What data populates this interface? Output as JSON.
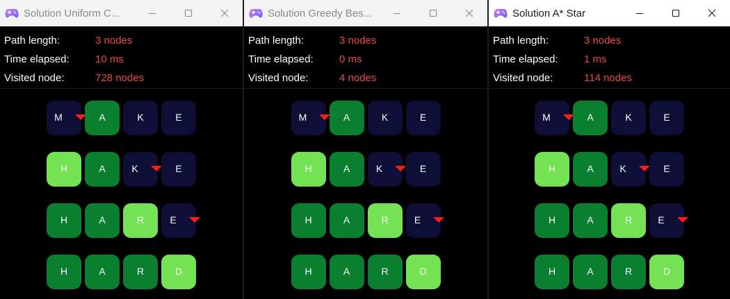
{
  "windows": [
    {
      "title": "Solution Uniform C...",
      "active": false,
      "stats": [
        {
          "label": "Path length:",
          "value": "3 nodes"
        },
        {
          "label": "Time elapsed:",
          "value": "10 ms"
        },
        {
          "label": "Visited node:",
          "value": "728 nodes"
        }
      ]
    },
    {
      "title": "Solution Greedy Bes...",
      "active": false,
      "stats": [
        {
          "label": "Path length:",
          "value": "3 nodes"
        },
        {
          "label": "Time elapsed:",
          "value": "0 ms"
        },
        {
          "label": "Visited node:",
          "value": "4 nodes"
        }
      ]
    },
    {
      "title": "Solution A* Star",
      "active": true,
      "stats": [
        {
          "label": "Path length:",
          "value": "3 nodes"
        },
        {
          "label": "Time elapsed:",
          "value": "1 ms"
        },
        {
          "label": "Visited node:",
          "value": "114 nodes"
        }
      ]
    }
  ],
  "word_ladder": [
    [
      {
        "c": "M",
        "s": "n",
        "mark": true
      },
      {
        "c": "A",
        "s": "g"
      },
      {
        "c": "K",
        "s": "n"
      },
      {
        "c": "E",
        "s": "n"
      }
    ],
    [
      {
        "c": "H",
        "s": "l"
      },
      {
        "c": "A",
        "s": "g"
      },
      {
        "c": "K",
        "s": "n",
        "mark": true
      },
      {
        "c": "E",
        "s": "n"
      }
    ],
    [
      {
        "c": "H",
        "s": "g"
      },
      {
        "c": "A",
        "s": "g"
      },
      {
        "c": "R",
        "s": "l"
      },
      {
        "c": "E",
        "s": "n",
        "mark": true
      }
    ],
    [
      {
        "c": "H",
        "s": "g"
      },
      {
        "c": "A",
        "s": "g"
      },
      {
        "c": "R",
        "s": "g"
      },
      {
        "c": "D",
        "s": "l"
      }
    ]
  ],
  "colors": {
    "unvisited_tile": "#0e0e37",
    "match_tile": "#097f2f",
    "changed_tile": "#73e253",
    "stat_value": "#e84a4a",
    "change_marker": "#ff1a1a"
  },
  "icons": {
    "app": "gamepad-icon",
    "minimize": "minimize-icon",
    "maximize": "maximize-icon",
    "close": "close-icon"
  }
}
